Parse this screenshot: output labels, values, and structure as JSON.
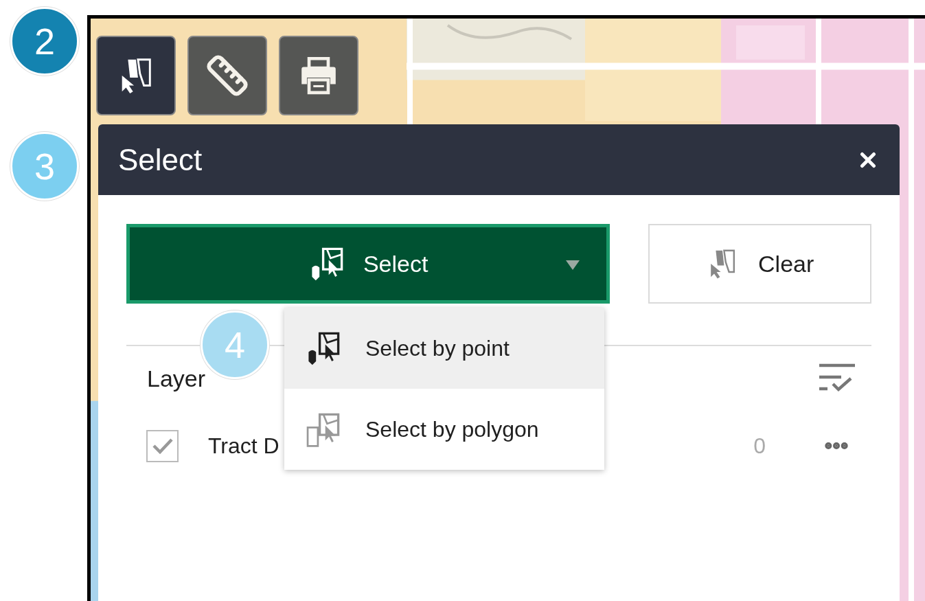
{
  "annotations": [
    {
      "label": "2",
      "color": "#1483b0"
    },
    {
      "label": "3",
      "color": "#7ccff0"
    },
    {
      "label": "4",
      "color": "#a8dcf2"
    }
  ],
  "toolbar": [
    {
      "kind": "select",
      "selected": true
    },
    {
      "kind": "measure",
      "selected": false
    },
    {
      "kind": "print",
      "selected": false
    }
  ],
  "panel": {
    "title": "Select",
    "select_button": {
      "label": "Select",
      "expanded": true
    },
    "clear_button": {
      "label": "Clear"
    },
    "menu": [
      {
        "kind": "point",
        "label": "Select by point",
        "selected": true
      },
      {
        "kind": "polygon",
        "label": "Select by polygon",
        "selected": false
      }
    ],
    "layer_header": "Layer",
    "layers": [
      {
        "name": "Tract D",
        "checked": true,
        "count": "0"
      }
    ]
  }
}
